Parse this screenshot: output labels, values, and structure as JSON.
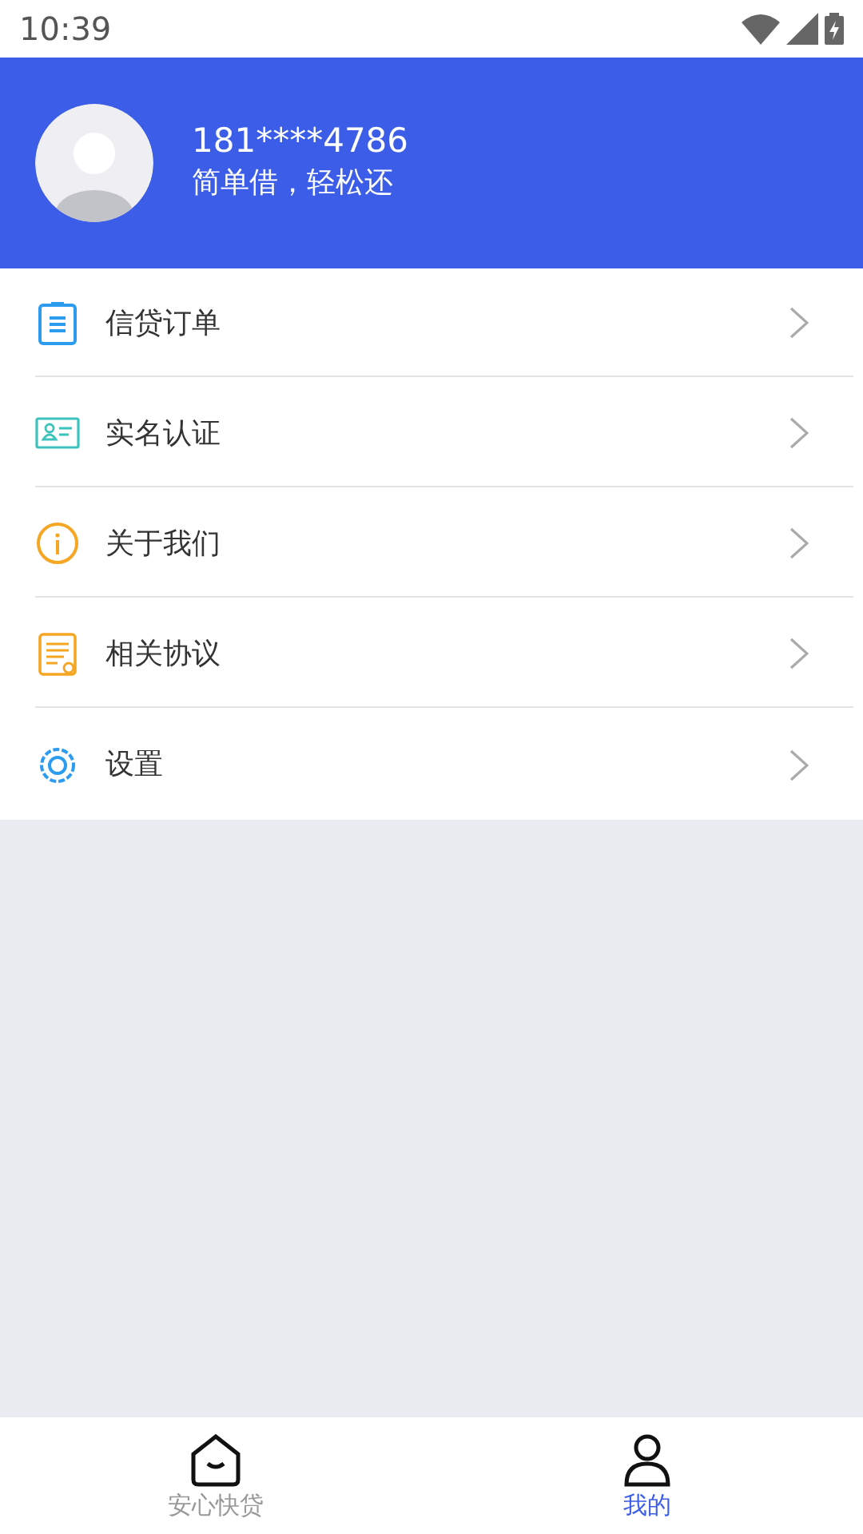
{
  "status_bar": {
    "time": "10:39"
  },
  "profile": {
    "phone": "181****4786",
    "slogan": "简单借，轻松还"
  },
  "menu": [
    {
      "label": "信贷订单",
      "kind": "clipboard",
      "color": "#2b9cf0"
    },
    {
      "label": "实名认证",
      "kind": "idcard",
      "color": "#3cc3bd"
    },
    {
      "label": "关于我们",
      "kind": "info",
      "color": "#f5a623"
    },
    {
      "label": "相关协议",
      "kind": "document",
      "color": "#f5a623"
    },
    {
      "label": "设置",
      "kind": "gear",
      "color": "#2b9cf0"
    }
  ],
  "tabs": [
    {
      "label": "安心快贷",
      "kind": "home",
      "selected": false
    },
    {
      "label": "我的",
      "kind": "person",
      "selected": true
    }
  ]
}
